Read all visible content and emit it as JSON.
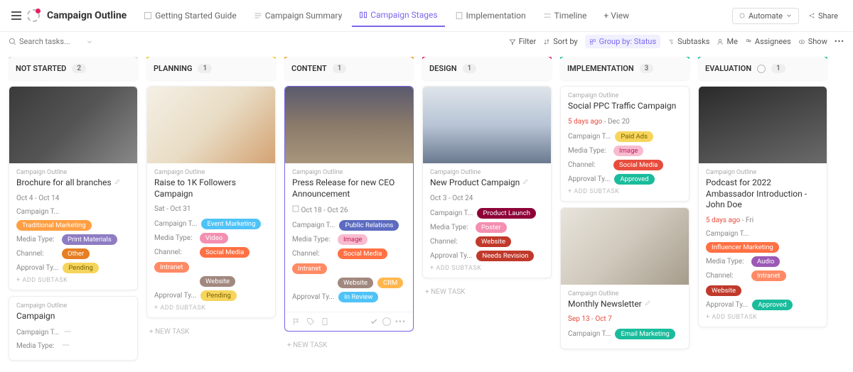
{
  "header": {
    "title": "Campaign Outline",
    "tabs": [
      {
        "label": "Getting Started Guide"
      },
      {
        "label": "Campaign Summary"
      },
      {
        "label": "Campaign Stages",
        "active": true
      },
      {
        "label": "Implementation"
      },
      {
        "label": "Timeline"
      },
      {
        "label": "+ View"
      }
    ],
    "automate": "Automate",
    "share": "Share"
  },
  "search": {
    "placeholder": "Search tasks..."
  },
  "toolbar": {
    "filter": "Filter",
    "sort": "Sort by",
    "group": "Group by: Status",
    "subtasks": "Subtasks",
    "me": "Me",
    "assignees": "Assignees",
    "show": "Show"
  },
  "columns": [
    {
      "name": "NOT STARTED",
      "count": "2",
      "stripe": "#ddd"
    },
    {
      "name": "PLANNING",
      "count": "1",
      "stripe": "#f1c40f"
    },
    {
      "name": "CONTENT",
      "count": "1",
      "stripe": "#f39c12"
    },
    {
      "name": "DESIGN",
      "count": "1",
      "stripe": "#e91e63"
    },
    {
      "name": "IMPLEMENTATION",
      "count": "3",
      "stripe": "#1abc9c"
    },
    {
      "name": "EVALUATION",
      "count": "1",
      "stripe": "#1abc9c",
      "check": true
    }
  ],
  "ui": {
    "crumb": "Campaign Outline",
    "addSubtask": "+ ADD SUBTASK",
    "newTask": "+ NEW TASK",
    "campaignT": "Campaign T...",
    "mediaType": "Media Type:",
    "channel": "Channel:",
    "approvalTy": "Approval Ty..."
  },
  "cards": {
    "c1": {
      "title": "Brochure for all branches",
      "date1": "Oct 4",
      "date2": "Oct 14",
      "campaign": {
        "text": "Traditional Marketing",
        "bg": "#ff9f43"
      },
      "media": {
        "text": "Print Materials",
        "bg": "#8e7cc3"
      },
      "channel": [
        {
          "text": "Other",
          "bg": "#e67e22"
        }
      ],
      "approval": {
        "text": "Pending",
        "bg": "#f6d55c",
        "fg": "#7a6000"
      }
    },
    "c1b": {
      "title": "Campaign"
    },
    "c2": {
      "title": "Raise to 1K Followers Campaign",
      "date1": "Sat",
      "date2": "Oct 31",
      "campaign": {
        "text": "Event Marketing",
        "bg": "#4fc3f7"
      },
      "media": {
        "text": "Video",
        "bg": "#f48fb1"
      },
      "channel": [
        {
          "text": "Social Media",
          "bg": "#ff7043"
        },
        {
          "text": "Intranet",
          "bg": "#ff8a65"
        },
        {
          "text": "Website",
          "bg": "#a1887f"
        }
      ],
      "approval": {
        "text": "Pending",
        "bg": "#f6d55c",
        "fg": "#7a6000"
      }
    },
    "c3": {
      "title": "Press Release for new CEO Announcement",
      "date1": "Oct 18",
      "date2": "Oct 26",
      "campaign": {
        "text": "Public Relations",
        "bg": "#5c6bc0"
      },
      "media": {
        "text": "Image",
        "bg": "#f8bbd0",
        "fg": "#c2185b"
      },
      "channel": [
        {
          "text": "Social Media",
          "bg": "#ff7043"
        },
        {
          "text": "Intranet",
          "bg": "#ff8a65"
        },
        {
          "text": "Website",
          "bg": "#a1887f"
        },
        {
          "text": "CRM",
          "bg": "#ffb74d"
        }
      ],
      "approval": {
        "text": "In Review",
        "bg": "#4fc3f7"
      }
    },
    "c4": {
      "title": "New Product Campaign",
      "date1": "Oct 3",
      "date2": "Oct 24",
      "campaign": {
        "text": "Product Launch",
        "bg": "#8e0038"
      },
      "media": {
        "text": "Poster",
        "bg": "#f48fb1"
      },
      "channel": [
        {
          "text": "Website",
          "bg": "#c0392b"
        }
      ],
      "approval": {
        "text": "Needs Revision",
        "bg": "#c0392b"
      }
    },
    "c5a": {
      "title": "Social PPC Traffic Campaign",
      "date1": "5 days ago",
      "date2": "Dec 20",
      "overdue": true,
      "campaign": {
        "text": "Paid Ads",
        "bg": "#f6d55c",
        "fg": "#7a6000"
      },
      "media": {
        "text": "Image",
        "bg": "#f8bbd0",
        "fg": "#c2185b"
      },
      "channel": [
        {
          "text": "Social Media",
          "bg": "#e74c3c"
        }
      ],
      "approval": {
        "text": "Approved",
        "bg": "#1abc9c"
      }
    },
    "c5b": {
      "title": "Monthly Newsletter",
      "date1": "Sep 13",
      "date2": "Oct 7",
      "overdue": true,
      "campaign": {
        "text": "Email Marketing",
        "bg": "#1abc9c"
      }
    },
    "c6": {
      "title": "Podcast for 2022 Ambassador Introduction - John Doe",
      "date1": "5 days ago",
      "date2": "Fri",
      "overdue": true,
      "campaign": {
        "text": "Influencer Marketing",
        "bg": "#ff7043"
      },
      "media": {
        "text": "Audio",
        "bg": "#9b59b6"
      },
      "channel": [
        {
          "text": "Intranet",
          "bg": "#ff8a65"
        },
        {
          "text": "Website",
          "bg": "#c0392b"
        }
      ],
      "approval": {
        "text": "Approved",
        "bg": "#1abc9c"
      }
    }
  }
}
